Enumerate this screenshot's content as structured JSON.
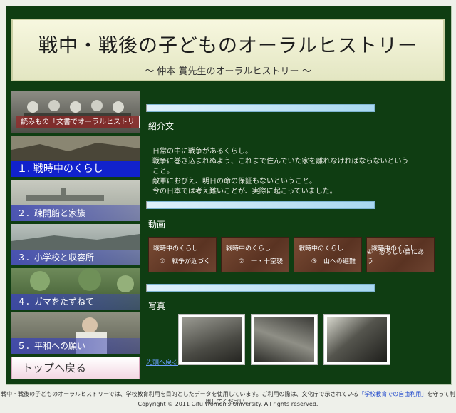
{
  "header": {
    "title": "戦中・戦後の子どものオーラルヒストリー",
    "subtitle": "〜 仲本 賞先生のオーラルヒストリー 〜"
  },
  "sidebar": {
    "read_label": "読みもの「文書でオーラルヒストリー」",
    "items": [
      {
        "label": "１. 戦時中のくらし"
      },
      {
        "label": "２．疎開船と家族"
      },
      {
        "label": "３．小学校と収容所"
      },
      {
        "label": "４．ガマをたずねて"
      },
      {
        "label": "５．平和への願い"
      }
    ],
    "top_button": "トップへ戻る"
  },
  "main": {
    "intro_title": "紹介文",
    "intro_text": "日常の中に戦争があるくらし。\n戦争に巻き込まれぬよう、これまで住んでいた家を離れなければならないということ。\n敵軍におびえ、明日の命の保証もないということ。\n今の日本では考え難いことが、実際に起こっていました。",
    "video_title": "動画",
    "videos": [
      {
        "title": "戦時中のくらし",
        "sub": "①　戦争が近づく"
      },
      {
        "title": "戦時中のくらし",
        "sub": "②　十・十空襲"
      },
      {
        "title": "戦時中のくらし",
        "sub": "③　山への避難"
      },
      {
        "title": "戦時中のくらし",
        "sub": "④　恐ろしい目にあう"
      }
    ],
    "photo_title": "写真",
    "back_link": "先頭へ戻る"
  },
  "footer": {
    "line1_pre": "戦中・戦後の子どものオーラルヒストリーでは、学校教育利用を目的としたデータを使用しています。ご利用の際は、文化庁で示されている",
    "line1_link": "「学校教育での自由利用」",
    "line1_post": "を守って利用してください。",
    "copyright": "Copyright © 2011 Gifu Women's University. All rights reserved."
  }
}
